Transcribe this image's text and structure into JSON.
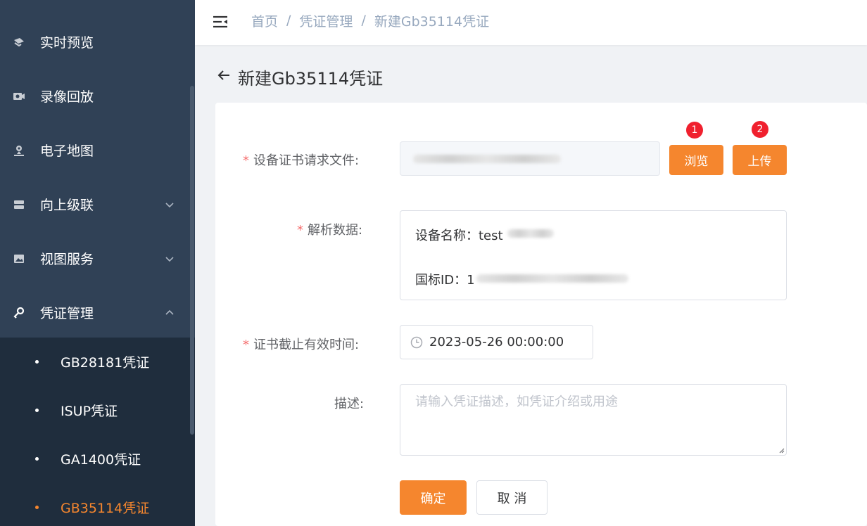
{
  "sidebar": {
    "items": [
      {
        "label": "实时预览",
        "icon": "video-camera-icon"
      },
      {
        "label": "录像回放",
        "icon": "playback-icon"
      },
      {
        "label": "电子地图",
        "icon": "map-pin-icon"
      },
      {
        "label": "向上级联",
        "icon": "server-icon"
      },
      {
        "label": "视图服务",
        "icon": "image-icon"
      },
      {
        "label": "凭证管理",
        "icon": "key-icon"
      }
    ],
    "submenu": [
      {
        "label": "GB28181凭证"
      },
      {
        "label": "ISUP凭证"
      },
      {
        "label": "GA1400凭证"
      },
      {
        "label": "GB35114凭证",
        "active": true
      }
    ]
  },
  "breadcrumb": {
    "home": "首页",
    "section": "凭证管理",
    "current": "新建Gb35114凭证"
  },
  "page": {
    "title": "新建Gb35114凭证"
  },
  "form": {
    "file_label": "设备证书请求文件:",
    "browse_label": "浏览",
    "browse_badge": "1",
    "upload_label": "上传",
    "upload_badge": "2",
    "parse_label": "解析数据:",
    "device_name_text": "设备名称：test",
    "national_id_text": "国标ID：1",
    "expiry_label": "证书截止有效时间:",
    "expiry_value": "2023-05-26 00:00:00",
    "desc_label": "描述:",
    "desc_placeholder": "请输入凭证描述，如凭证介绍或用途",
    "confirm_label": "确定",
    "cancel_label": "取 消"
  },
  "colors": {
    "accent": "#f5862e",
    "sidebar_bg": "#304156",
    "submenu_bg": "#1f2d3d",
    "required": "#f56c6c",
    "badge": "#f0202e"
  }
}
